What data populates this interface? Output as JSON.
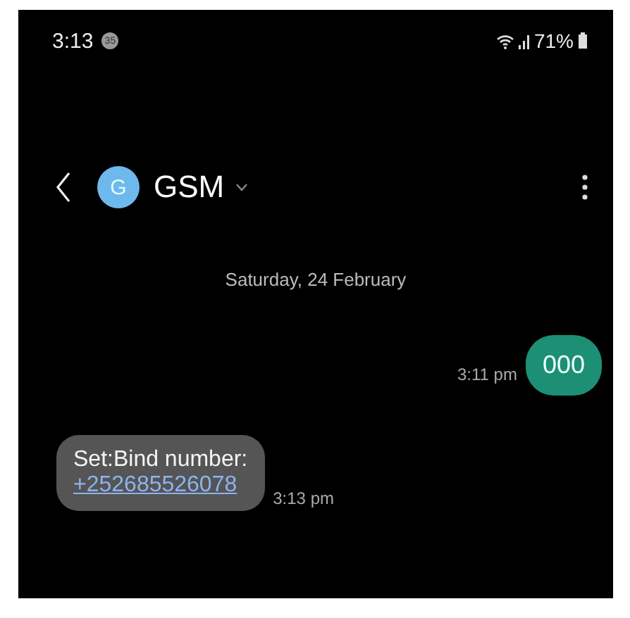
{
  "status_bar": {
    "time": "3:13",
    "notification_count": "35",
    "battery": "71%"
  },
  "header": {
    "avatar_letter": "G",
    "title": "GSM"
  },
  "date_divider": "Saturday, 24 February",
  "messages": [
    {
      "kind": "sent",
      "text": "000",
      "time": "3:11 pm"
    },
    {
      "kind": "received",
      "text": "Set:Bind number:",
      "link": "+252685526078",
      "time": "3:13 pm"
    }
  ]
}
